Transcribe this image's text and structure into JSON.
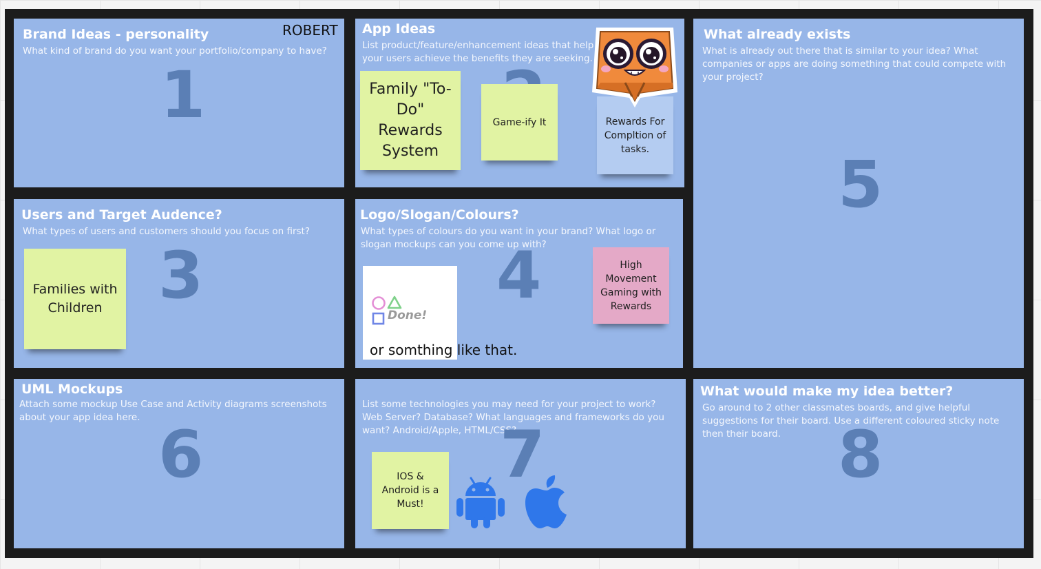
{
  "board": {
    "author": "ROBERT",
    "panels": {
      "p1": {
        "title": "Brand Ideas - personality",
        "desc": "What kind of brand do you want your portfolio/company to have?",
        "num": "1"
      },
      "p2": {
        "title": "App Ideas",
        "desc": "List product/feature/enhancement ideas that help your users achieve the benefits they are seeking.",
        "num": "2"
      },
      "p3": {
        "title": "Users and Target Audence?",
        "desc": "What types of users and customers should you focus on first?",
        "num": "3"
      },
      "p4": {
        "title": "Logo/Slogan/Colours?",
        "desc": "What types of colours do you want in your brand? What logo or slogan mockups can you come up with?",
        "num": "4"
      },
      "p5": {
        "title": "What already exists",
        "desc": "What is already out there that is similar to your idea? What companies or apps are doing something that could compete with your project?",
        "num": "5"
      },
      "p6": {
        "title": "UML Mockups",
        "desc": "Attach some mockup Use Case and Activity diagrams screenshots about your app idea here.",
        "num": "6"
      },
      "p7": {
        "desc": "List some technologies you may need for your project to work? Web Server? Database? What languages and frameworks do you want? Android/Apple, HTML/CSS?",
        "num": "7"
      },
      "p8": {
        "title": "What would make my idea better?",
        "desc": "Go around to 2 other classmates boards, and give helpful suggestions for their board. Use a different coloured sticky note then their board.",
        "num": "8"
      }
    },
    "stickies": {
      "family_todo": "Family \"To-Do\" Rewards System",
      "gameify": "Game-ify It",
      "rewards_completion": "Rewards For Compltion of tasks.",
      "families": "Families with Children",
      "high_movement": "High Movement Gaming with Rewards",
      "ios_android": "IOS & Android is a Must!"
    },
    "logo": {
      "word": "Done!",
      "caption": "or somthing like that."
    }
  },
  "colors": {
    "panel": "#97b6e8",
    "board_frame": "#1c1c1c",
    "sticky_green": "#e1f3a3",
    "sticky_pink": "#e4a9c7",
    "sticky_light_blue": "#b4ccf1",
    "big_number": "#5b7fb5",
    "platform_icons": "#2f77ea"
  },
  "icons": [
    "cartoon-mascot-sticker",
    "android-icon",
    "apple-icon",
    "circle-shape-icon",
    "triangle-shape-icon",
    "square-shape-icon"
  ]
}
